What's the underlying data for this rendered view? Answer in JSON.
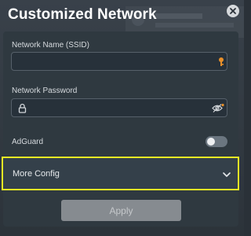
{
  "dialog": {
    "title": "Customized Network",
    "close_icon": "close-icon"
  },
  "fields": {
    "ssid": {
      "label": "Network Name (SSID)",
      "value": "",
      "icon": "key-icon"
    },
    "password": {
      "label": "Network Password",
      "value": "",
      "lock_icon": "lock-icon",
      "visibility_icon": "eye-slash-icon"
    }
  },
  "adguard": {
    "label": "AdGuard",
    "enabled": false
  },
  "more_config": {
    "label": "More Config",
    "icon": "chevron-down-icon"
  },
  "apply": {
    "label": "Apply",
    "disabled": true
  },
  "colors": {
    "accent_orange": "#e8902a",
    "highlight_yellow": "#e8ea24"
  }
}
